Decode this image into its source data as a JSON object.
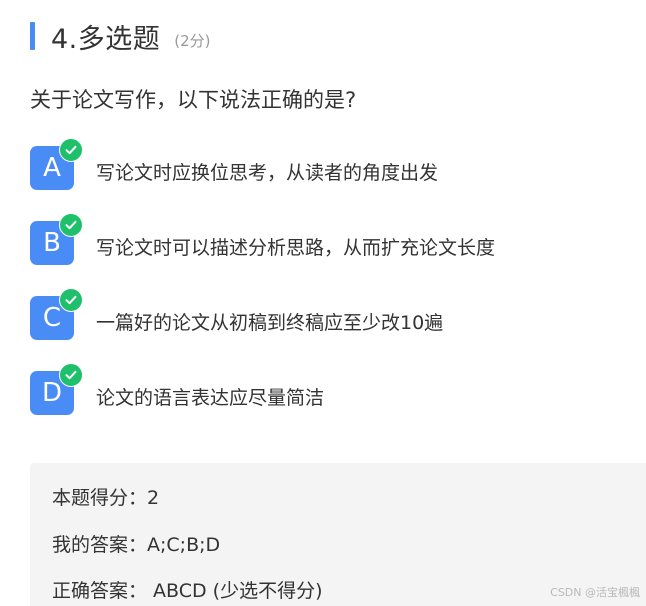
{
  "header": {
    "title": "4.多选题",
    "score": "(2分)",
    "accent_color": "#4a8cf6"
  },
  "question": {
    "text": "关于论文写作，以下说法正确的是?"
  },
  "options": [
    {
      "letter": "A",
      "text": "写论文时应换位思考，从读者的角度出发",
      "selected": true
    },
    {
      "letter": "B",
      "text": "写论文时可以描述分析思路，从而扩充论文长度",
      "selected": true
    },
    {
      "letter": "C",
      "text": "一篇好的论文从初稿到终稿应至少改10遍",
      "selected": true
    },
    {
      "letter": "D",
      "text": "论文的语言表达应尽量简洁",
      "selected": true
    }
  ],
  "result": {
    "score_line": "本题得分：2",
    "my_answer_line": "我的答案：A;C;B;D",
    "correct_answer_line": "正确答案： ABCD (少选不得分)"
  },
  "watermark": "CSDN @活宝楓楓",
  "colors": {
    "badge": "#4a8cf6",
    "check": "#1fc06b",
    "result_bg": "#f4f4f5"
  },
  "icons": {
    "selected": "check-circle-icon"
  }
}
